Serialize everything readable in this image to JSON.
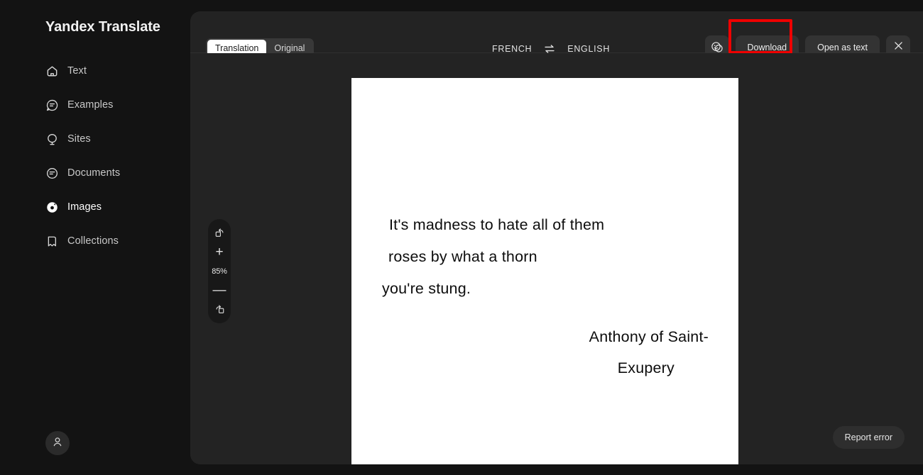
{
  "brand": {
    "title": "Yandex Translate"
  },
  "sidebar": {
    "items": [
      {
        "label": "Text",
        "icon": "home-icon"
      },
      {
        "label": "Examples",
        "icon": "examples-bubble-icon"
      },
      {
        "label": "Sites",
        "icon": "sites-balloon-icon"
      },
      {
        "label": "Documents",
        "icon": "documents-icon"
      },
      {
        "label": "Images",
        "icon": "images-icon"
      },
      {
        "label": "Collections",
        "icon": "collections-icon"
      }
    ],
    "active_index": 4,
    "account_icon": "person-icon"
  },
  "header": {
    "toggle": {
      "translation_label": "Translation",
      "original_label": "Original",
      "selected": "Translation"
    },
    "source_language": "FRENCH",
    "target_language": "ENGLISH",
    "swap_icon": "swap-arrows-icon",
    "stickers_icon": "emoji-stickers-icon",
    "download_label": "Download",
    "open_as_text_label": "Open as text",
    "close_icon": "close-icon",
    "highlight_color": "#ef0000",
    "highlight_target": "Download"
  },
  "viewer": {
    "zoom_controls": {
      "rotate_left_icon": "rotate-left-icon",
      "zoom_in_label": "+",
      "zoom_level": "85%",
      "zoom_out_label": "—",
      "rotate_right_icon": "rotate-right-icon"
    },
    "document": {
      "body_lines": [
        "It's madness to hate all of them",
        "roses by what a thorn",
        "you're stung."
      ],
      "attribution_lines": [
        "Anthony of Saint-",
        "Exupery"
      ]
    },
    "report_error_label": "Report error"
  }
}
